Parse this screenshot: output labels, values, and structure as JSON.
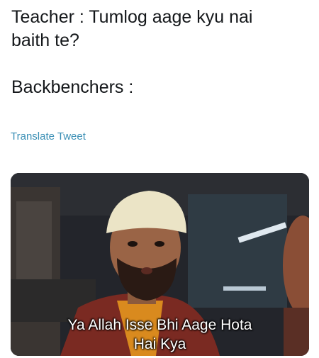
{
  "tweet": {
    "lines": [
      "Teacher : Tumlog aage kyu nai",
      "baith te?",
      "Backbenchers :"
    ],
    "translate_label": "Translate Tweet"
  },
  "media": {
    "subtitle_lines": [
      "Ya Allah Isse Bhi Aage Hota",
      "Hai Kya"
    ]
  },
  "colors": {
    "text": "#14171a",
    "link": "#3a8fb5",
    "media_bg": "#1b1d22"
  }
}
